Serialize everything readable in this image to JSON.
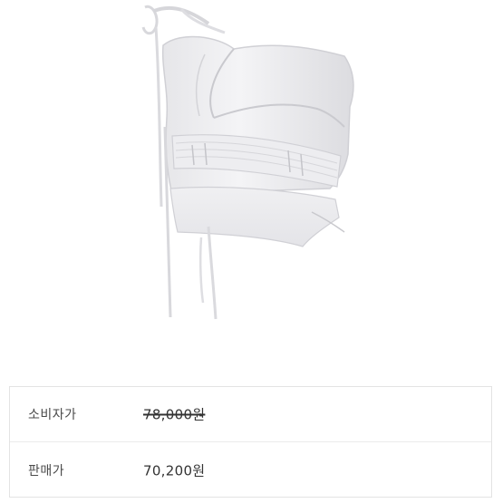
{
  "pricing": {
    "consumer_price_label": "소비자가",
    "consumer_price_value": "78,000원",
    "sale_price_label": "판매가",
    "sale_price_value": "70,200원"
  },
  "colors": {
    "border": "#e3e3e3",
    "text": "#333333",
    "garment": "#f2f2f4"
  }
}
